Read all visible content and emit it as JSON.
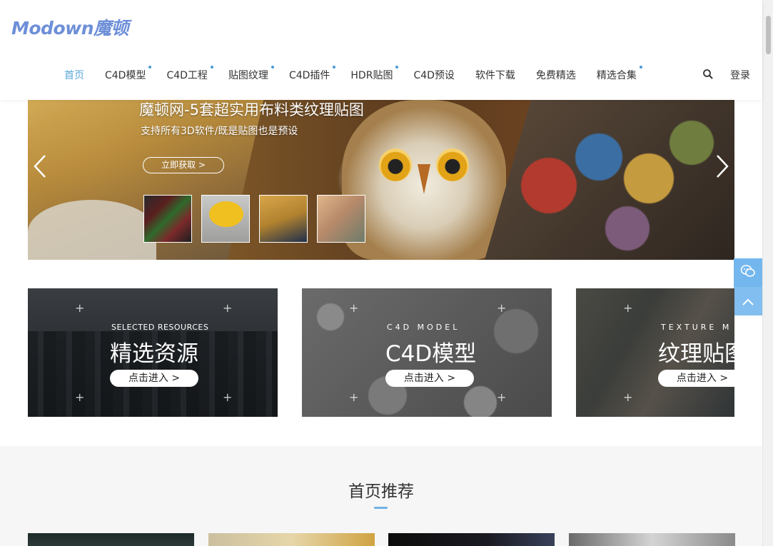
{
  "header": {
    "logo": "Modown魔顿",
    "nav": [
      {
        "label": "首页",
        "active": true,
        "dot": false
      },
      {
        "label": "C4D模型",
        "active": false,
        "dot": true
      },
      {
        "label": "C4D工程",
        "active": false,
        "dot": true
      },
      {
        "label": "贴图纹理",
        "active": false,
        "dot": true
      },
      {
        "label": "C4D插件",
        "active": false,
        "dot": true
      },
      {
        "label": "HDR贴图",
        "active": false,
        "dot": true
      },
      {
        "label": "C4D预设",
        "active": false,
        "dot": false
      },
      {
        "label": "软件下载",
        "active": false,
        "dot": false
      },
      {
        "label": "免费精选",
        "active": false,
        "dot": false
      },
      {
        "label": "精选合集",
        "active": false,
        "dot": true
      }
    ],
    "login": "登录",
    "search_icon": "search-icon"
  },
  "banner": {
    "title": "魔顿网-5套超实用布料类纹理贴图",
    "subtitle": "支持所有3D软件/既是贴图也是预设",
    "button": "立即获取 >",
    "prev_icon": "chevron-left-icon",
    "next_icon": "chevron-right-icon"
  },
  "cards": [
    {
      "en": "SELECTED RESOURCES",
      "cn": "精选资源",
      "button": "点击进入 >"
    },
    {
      "en": "C4D MODEL",
      "cn": "C4D模型",
      "button": "点击进入 >"
    },
    {
      "en": "TEXTURE M",
      "cn": "纹理贴图",
      "button": "点击进入 >"
    }
  ],
  "float": {
    "wechat_icon": "wechat-icon",
    "top_icon": "chevron-up-icon"
  },
  "section": {
    "title": "首页推荐"
  },
  "colors": {
    "accent": "#5aa7d8",
    "logo": "#6e8fd8",
    "float": "#74b7ee"
  }
}
